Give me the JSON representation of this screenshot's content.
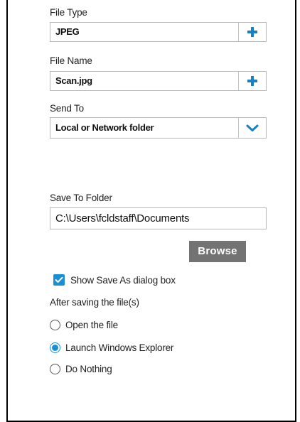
{
  "file_type": {
    "label": "File Type",
    "value": "JPEG",
    "action_icon": "plus-icon"
  },
  "file_name": {
    "label": "File Name",
    "value": "Scan.jpg",
    "action_icon": "plus-icon"
  },
  "send_to": {
    "label": "Send To",
    "value": "Local or Network folder",
    "action_icon": "chevron-down-icon"
  },
  "save_to_folder": {
    "label": "Save To Folder",
    "value": "C:\\Users\\fcldstaff\\Documents"
  },
  "browse_label": "Browse",
  "show_save_as": {
    "label": "Show Save As dialog box",
    "checked": true
  },
  "after_saving": {
    "heading": "After saving the file(s)",
    "options": [
      {
        "label": "Open the file",
        "selected": false
      },
      {
        "label": "Launch Windows Explorer",
        "selected": true
      },
      {
        "label": "Do Nothing",
        "selected": false
      }
    ]
  },
  "colors": {
    "accent": "#1a8fd6",
    "browse_button": "#737373",
    "field_border": "#b9b9b9"
  }
}
